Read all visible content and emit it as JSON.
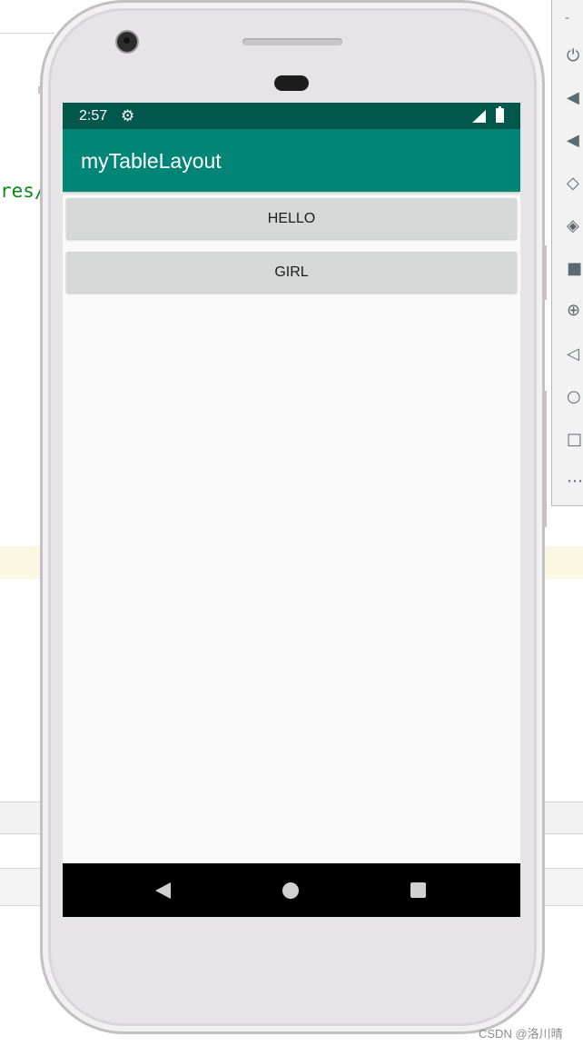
{
  "ide": {
    "code_fragment": "res/"
  },
  "emulator_toolbar": {
    "minimize_label": "-",
    "more_label": "⋯"
  },
  "status_bar": {
    "time": "2:57",
    "icons": [
      "gear-icon",
      "signal-icon",
      "battery-icon"
    ]
  },
  "app_bar": {
    "title": "myTableLayout"
  },
  "buttons": [
    {
      "label": "HELLO"
    },
    {
      "label": "GIRL"
    }
  ],
  "nav_bar": {
    "icons": [
      "back-icon",
      "home-icon",
      "recents-icon"
    ]
  },
  "colors": {
    "status_bar": "#00574b",
    "app_bar": "#008577",
    "button_bg": "#d6d7d7",
    "screen_bg": "#fafafa"
  },
  "watermark": "CSDN @洛川晴"
}
